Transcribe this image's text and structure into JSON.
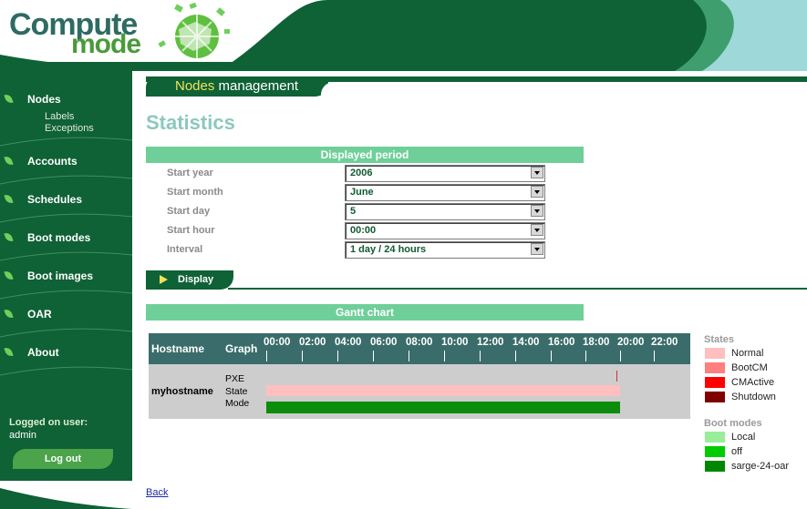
{
  "logo": {
    "word1": "Compute",
    "word2": "mode"
  },
  "sidebar": {
    "items": [
      {
        "label": "Nodes"
      },
      {
        "label": "Accounts"
      },
      {
        "label": "Schedules"
      },
      {
        "label": "Boot modes"
      },
      {
        "label": "Boot images"
      },
      {
        "label": "OAR"
      },
      {
        "label": "About"
      }
    ],
    "subitems": [
      "Labels",
      "Exceptions"
    ],
    "logged_label": "Logged on user:",
    "logged_user": "admin",
    "logout_label": "Log out"
  },
  "tab": {
    "highlight": "Nodes",
    "rest": " management"
  },
  "page_title": "Statistics",
  "period": {
    "section_title": "Displayed period",
    "fields": [
      {
        "label": "Start year",
        "value": "2006"
      },
      {
        "label": "Start month",
        "value": "June"
      },
      {
        "label": "Start day",
        "value": "5"
      },
      {
        "label": "Start hour",
        "value": "00:00"
      },
      {
        "label": "Interval",
        "value": "1 day / 24 hours"
      }
    ],
    "display_label": "Display"
  },
  "gantt": {
    "section_title": "Gantt chart",
    "col_hostname": "Hostname",
    "col_graph": "Graph",
    "hours": [
      "00:00",
      "02:00",
      "04:00",
      "06:00",
      "08:00",
      "10:00",
      "12:00",
      "14:00",
      "16:00",
      "18:00",
      "20:00",
      "22:00"
    ],
    "host": "myhostname",
    "row_labels": [
      "PXE",
      "State",
      "Mode"
    ]
  },
  "legend": {
    "states_title": "States",
    "states": [
      {
        "label": "Normal",
        "color": "#ffbfbf"
      },
      {
        "label": "BootCM",
        "color": "#ff7f7f"
      },
      {
        "label": "CMActive",
        "color": "#ff0000"
      },
      {
        "label": "Shutdown",
        "color": "#800000"
      }
    ],
    "boot_title": "Boot modes",
    "boot_modes": [
      {
        "label": "Local",
        "color": "#99ee99"
      },
      {
        "label": "off",
        "color": "#00cc00"
      },
      {
        "label": "sarge-24-oar",
        "color": "#008800"
      }
    ]
  },
  "back_label": "Back",
  "colors": {
    "sidebar": "#0f6136",
    "accent": "#6fcf99",
    "header_teal": "#396c6a"
  }
}
